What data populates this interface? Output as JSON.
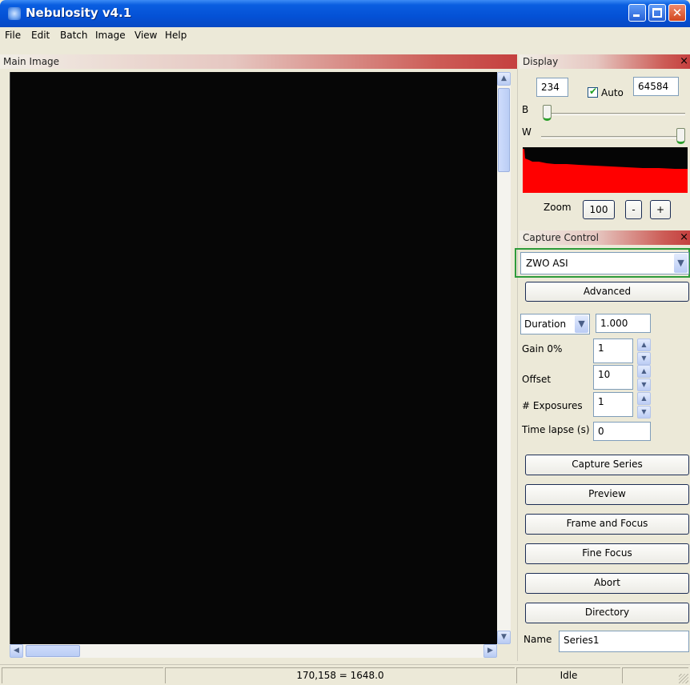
{
  "window": {
    "title": "Nebulosity v4.1"
  },
  "menu": [
    "File",
    "Edit",
    "Batch",
    "Image",
    "View",
    "Help"
  ],
  "main_pane": {
    "title": "Main Image"
  },
  "display": {
    "title": "Display",
    "close_label": "×",
    "black_value": "234",
    "auto_label": "Auto",
    "auto_checked": true,
    "white_value": "64584",
    "b_label": "B",
    "w_label": "W",
    "b_level_fraction": 0.0,
    "w_level_fraction": 1.0,
    "zoom_label": "Zoom",
    "zoom_value": "100",
    "zoom_out_label": "-",
    "zoom_in_label": "+",
    "histogram_color": "#ff0000"
  },
  "capture": {
    "title": "Capture Control",
    "close_label": "×",
    "camera": "ZWO ASI",
    "advanced_label": "Advanced",
    "duration_mode": "Duration",
    "duration_value": "1.000",
    "gain_label": "Gain 0%",
    "gain_value": "1",
    "offset_label": "Offset",
    "offset_value": "10",
    "exposures_label": "# Exposures",
    "exposures_value": "1",
    "timelapse_label": "Time lapse (s)",
    "timelapse_value": "0",
    "buttons": [
      "Capture Series",
      "Preview",
      "Frame and Focus",
      "Fine Focus",
      "Abort",
      "Directory"
    ],
    "name_label": "Name",
    "name_value": "Series1"
  },
  "status": {
    "coords": "170,158 = 1648.0",
    "state": "Idle"
  },
  "colors": {
    "titlebar": "#0451d6",
    "pane_header_accent": "#c5403f",
    "camera_highlight": "#2e9b3a"
  }
}
